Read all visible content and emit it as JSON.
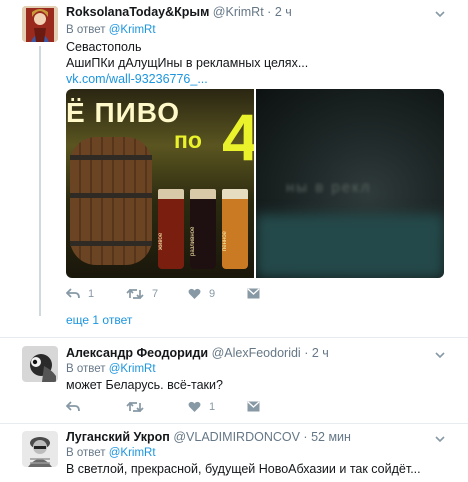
{
  "tweets": [
    {
      "name": "RoksolanaToday&Крым",
      "handle": "@KrimRt",
      "time": "2 ч",
      "reply_prefix": "В ответ",
      "reply_to": "@KrimRt",
      "lines": [
        "Севастополь",
        "АшиПКи дАлущИны в рекламных целях..."
      ],
      "link": "vk.com/wall-93236776_...",
      "media": {
        "left": {
          "headline": "Ё ПИВО",
          "word": "по",
          "number": "4",
          "glass_labels": [
            "живое",
            "разливное",
            "пенное"
          ]
        },
        "right": {
          "blurred_text": "ны в рекл"
        }
      },
      "actions": {
        "replies": "1",
        "retweets": "7",
        "likes": "9"
      },
      "more_replies": "еще 1 ответ"
    },
    {
      "name": "Александр Феодориди",
      "handle": "@AlexFeodoridi",
      "time": "2 ч",
      "reply_prefix": "В ответ",
      "reply_to": "@KrimRt",
      "lines": [
        "может Беларусь. всё-таки?"
      ],
      "actions": {
        "replies": "",
        "retweets": "",
        "likes": "1"
      }
    },
    {
      "name": "Луганский Укроп",
      "handle": "@VLADIMIRDONCOV",
      "time": "52 мин",
      "reply_prefix": "В ответ",
      "reply_to": "@KrimRt",
      "lines": [
        "В светлой, прекрасной, будущей НовоАбхазии и так сойдёт..."
      ]
    }
  ],
  "separator": "·",
  "icons": [
    "reply-icon",
    "retweet-icon",
    "like-icon",
    "direct-message-icon",
    "chevron-down-icon"
  ],
  "colors": {
    "link": "#1b95e0",
    "muted": "#657786",
    "icon": "#8899a6",
    "divider": "#e6ecf0"
  }
}
